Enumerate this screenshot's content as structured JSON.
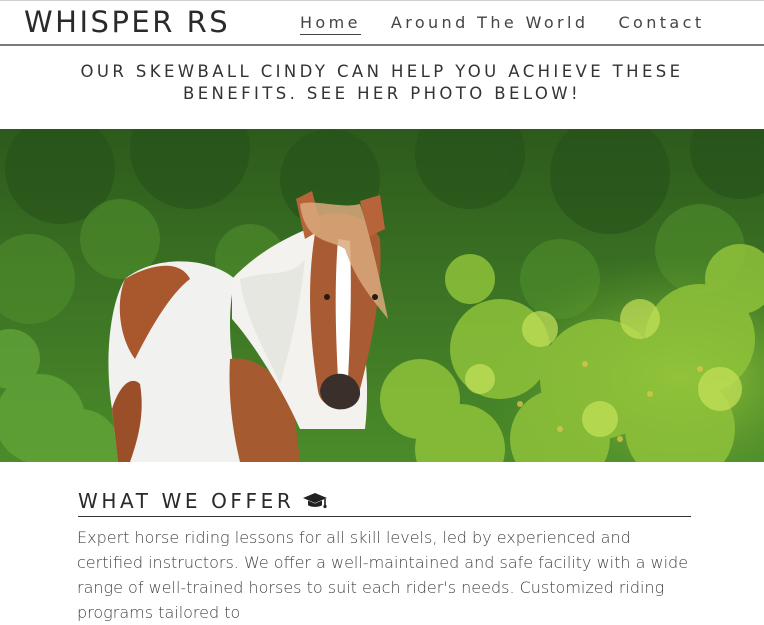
{
  "site": {
    "brand": "WHISPER RS"
  },
  "nav": {
    "items": [
      {
        "label": "Home"
      },
      {
        "label": "Around The World"
      },
      {
        "label": "Contact"
      }
    ]
  },
  "hero": {
    "tagline": "OUR SKEWBALL CINDY CAN HELP YOU ACHIEVE THESE BENEFITS. SEE HER PHOTO BELOW!"
  },
  "offer": {
    "title": "WHAT WE OFFER",
    "icon": "graduation-cap-icon",
    "body": "Expert horse riding lessons for all skill levels, led by experienced and certified instructors. We offer a well-maintained and safe facility with a wide range of well-trained horses to suit each rider's needs. Customized riding programs tailored to"
  },
  "colors": {
    "text": "#2a2a2a",
    "rule": "#333333",
    "foliage": "#3f7e24",
    "horse": "#a85a32"
  }
}
